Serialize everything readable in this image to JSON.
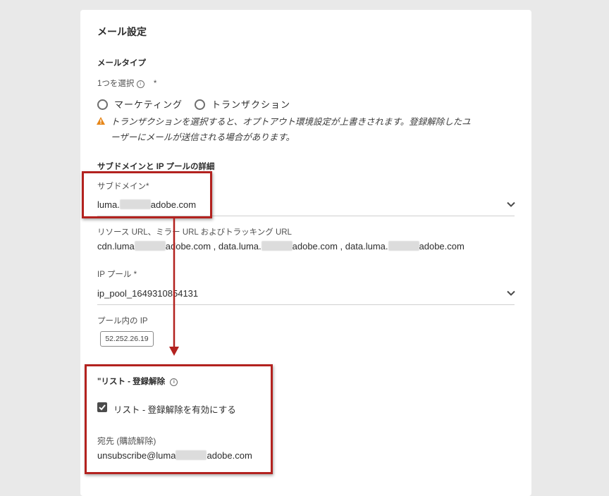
{
  "header": {
    "title": "メール設定"
  },
  "email_type": {
    "heading": "メールタイプ",
    "select_label": "1つを選択",
    "required_mark": "*",
    "options": [
      {
        "label": "マーケティング"
      },
      {
        "label": "トランザクション"
      }
    ],
    "warning_line1": "トランザクションを選択すると、オプトアウト環境設定が上書きされます。登録解除したユ",
    "warning_line2": "ーザーにメールが送信される場合があります。"
  },
  "subdomain_section": {
    "heading": "サブドメインと IP プールの詳細",
    "subdomain_label": "サブドメイン",
    "required_mark": "*",
    "subdomain_prefix": "luma.",
    "subdomain_suffix": "adobe.com",
    "urls_label": "リソース URL、ミラー URL およびトラッキング URL",
    "urls": [
      {
        "prefix": "cdn.luma",
        "suffix": "adobe.com ,"
      },
      {
        "prefix": "data.luma.",
        "suffix": "adobe.com ,"
      },
      {
        "prefix": "data.luma.",
        "suffix": "adobe.com"
      }
    ],
    "ip_pool_label": "IP プール",
    "ip_pool_value": "ip_pool_1649310854131",
    "pool_ips_label": "プール内の IP",
    "pool_ip": "52.252.26.19"
  },
  "list_unsubscribe": {
    "heading": "\"リスト - 登録解除",
    "checkbox_label": "リスト - 登録解除を有効にする",
    "checked": true,
    "dest_label": "宛先 (購読解除)",
    "dest_prefix": "unsubscribe@luma",
    "dest_suffix": "adobe.com"
  },
  "colors": {
    "highlight": "#b3221f",
    "warning": "#e68619",
    "background": "#e9e9e9"
  }
}
